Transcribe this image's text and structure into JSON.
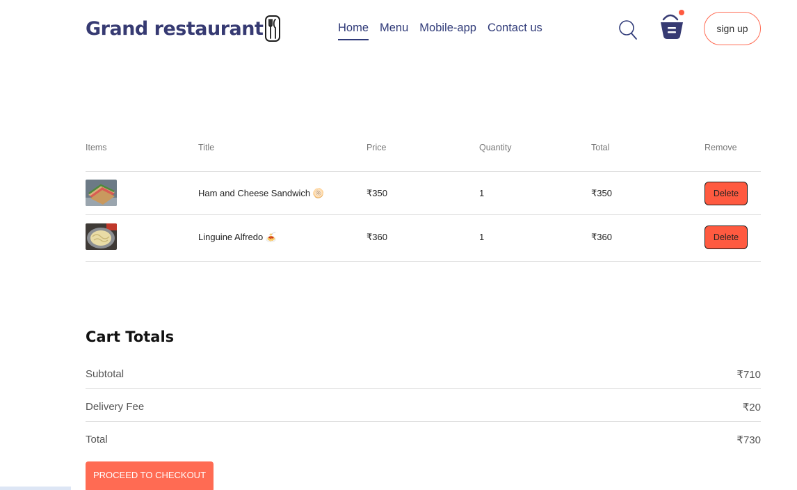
{
  "header": {
    "logo": "Grand restaurant",
    "nav": [
      "Home",
      "Menu",
      "Mobile-app",
      "Contact us"
    ],
    "active_nav": "Home",
    "signup_label": "sign up",
    "cart_has_items": true
  },
  "cart": {
    "columns": [
      "Items",
      "Title",
      "Price",
      "Quantity",
      "Total",
      "Remove"
    ],
    "rows": [
      {
        "title": "Ham and Cheese Sandwich 🫓",
        "price": "₹350",
        "quantity": "1",
        "total": "₹350",
        "remove_label": "Delete",
        "image": "sandwich-thumbnail"
      },
      {
        "title": "Linguine Alfredo 🍝",
        "price": "₹360",
        "quantity": "1",
        "total": "₹360",
        "remove_label": "Delete",
        "image": "pasta-thumbnail"
      }
    ]
  },
  "totals": {
    "title": "Cart Totals",
    "rows": [
      {
        "label": "Subtotal",
        "value": "₹710"
      },
      {
        "label": "Delivery Fee",
        "value": "₹20"
      },
      {
        "label": "Total",
        "value": "₹730"
      }
    ],
    "checkout_label": "PROCEED TO CHECKOUT"
  },
  "colors": {
    "brand": "#363a72",
    "accent": "#ff6b53",
    "delete": "#ff5a40"
  }
}
